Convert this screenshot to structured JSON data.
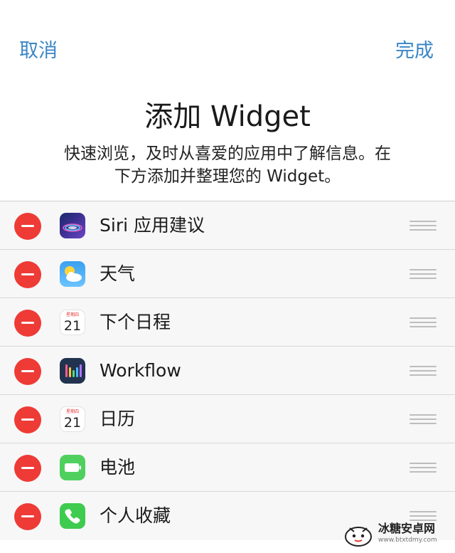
{
  "nav": {
    "cancel_label": "取消",
    "done_label": "完成"
  },
  "header": {
    "title": "添加 Widget",
    "subtitle_line1": "快速浏览，及时从喜爱的应用中了解信息。在",
    "subtitle_line2": "下方添加并整理您的 Widget。"
  },
  "widgets": [
    {
      "label": "Siri 应用建议",
      "icon": "siri-icon"
    },
    {
      "label": "天气",
      "icon": "weather-icon"
    },
    {
      "label": "下个日程",
      "icon": "calendar-icon",
      "cal_day": "星期四",
      "cal_num": "21"
    },
    {
      "label": "Workflow",
      "icon": "workflow-icon"
    },
    {
      "label": "日历",
      "icon": "calendar-icon",
      "cal_day": "星期四",
      "cal_num": "21"
    },
    {
      "label": "电池",
      "icon": "battery-icon"
    },
    {
      "label": "个人收藏",
      "icon": "phone-icon"
    }
  ],
  "watermark": {
    "text": "冰糖安卓网",
    "url": "www.btxtdmy.com"
  },
  "colors": {
    "accent": "#3a86c6",
    "remove": "#ee3b36"
  }
}
